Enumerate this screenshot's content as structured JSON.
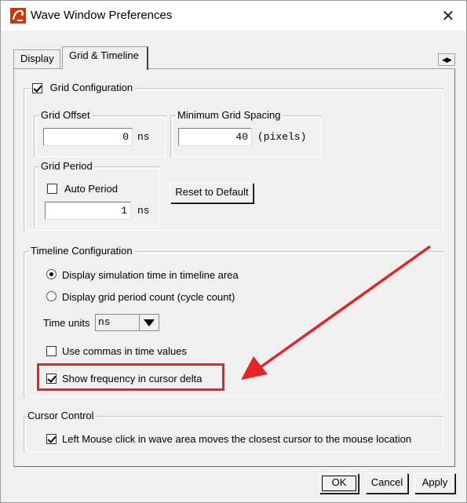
{
  "window": {
    "title": "Wave Window Preferences",
    "close_glyph": "✕"
  },
  "tabs": [
    {
      "label": "Display"
    },
    {
      "label": "Grid & Timeline"
    }
  ],
  "tab_scroll": "◀▶",
  "grid_config": {
    "title": "Grid Configuration",
    "enabled": true,
    "offset": {
      "legend": "Grid Offset",
      "value": "0",
      "unit": "ns"
    },
    "min_spacing": {
      "legend": "Minimum Grid Spacing",
      "value": "40",
      "unit": "(pixels)"
    },
    "period": {
      "legend": "Grid Period",
      "auto_label": "Auto Period",
      "auto_checked": false,
      "value": "1",
      "unit": "ns"
    },
    "reset_button": "Reset to Default"
  },
  "timeline_config": {
    "title": "Timeline Configuration",
    "radio_sim_time": "Display simulation time in timeline area",
    "radio_grid_count": "Display grid period count (cycle count)",
    "time_units_label": "Time units",
    "time_units_value": "ns",
    "commas_label": "Use commas in time values",
    "commas_checked": false,
    "frequency_label": "Show frequency in cursor delta",
    "frequency_checked": true
  },
  "cursor_control": {
    "title": "Cursor Control",
    "left_mouse_label": "Left Mouse click in wave area moves the closest cursor to the mouse location",
    "left_mouse_checked": true
  },
  "buttons": {
    "ok": "OK",
    "cancel": "Cancel",
    "apply": "Apply"
  },
  "colors": {
    "annotation": "#e0252b",
    "app_icon": "#c8390f"
  }
}
